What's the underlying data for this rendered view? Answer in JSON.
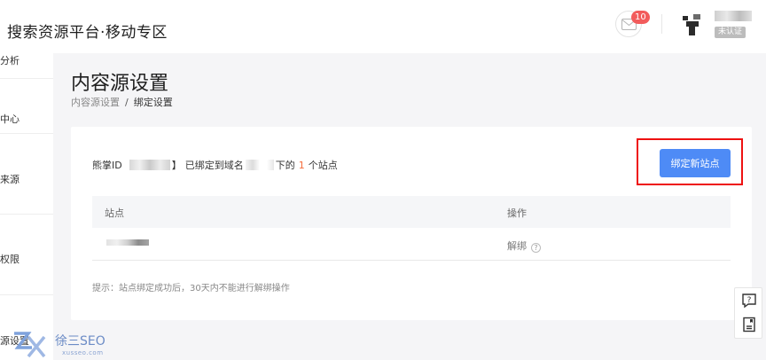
{
  "header": {
    "title": "搜索资源平台·移动专区",
    "mail_badge": "10",
    "verify_tag": "未认证"
  },
  "sidebar": {
    "items": [
      "统计分析",
      "服务中心",
      "数据来源",
      "权限",
      "资源设置"
    ]
  },
  "page": {
    "title": "内容源设置",
    "breadcrumb": [
      "内容源设置",
      "绑定设置"
    ]
  },
  "binding": {
    "prefix": "熊掌ID",
    "bracket_close": "】",
    "bound_text": "已绑定到域名",
    "under_text": "下的",
    "count": "1",
    "suffix": "个站点",
    "bind_button": "绑定新站点"
  },
  "table": {
    "columns": [
      "站点",
      "操作"
    ],
    "rows": [
      {
        "action": "解绑"
      }
    ]
  },
  "tip": "提示：站点绑定成功后，30天内不能进行解绑操作",
  "watermark": {
    "name": "徐三SEO",
    "url": "xusseo.com"
  },
  "colors": {
    "primary": "#4e8bf6",
    "highlight": "#ee1111",
    "count": "#f56c3a",
    "badge": "#f25c5c"
  }
}
